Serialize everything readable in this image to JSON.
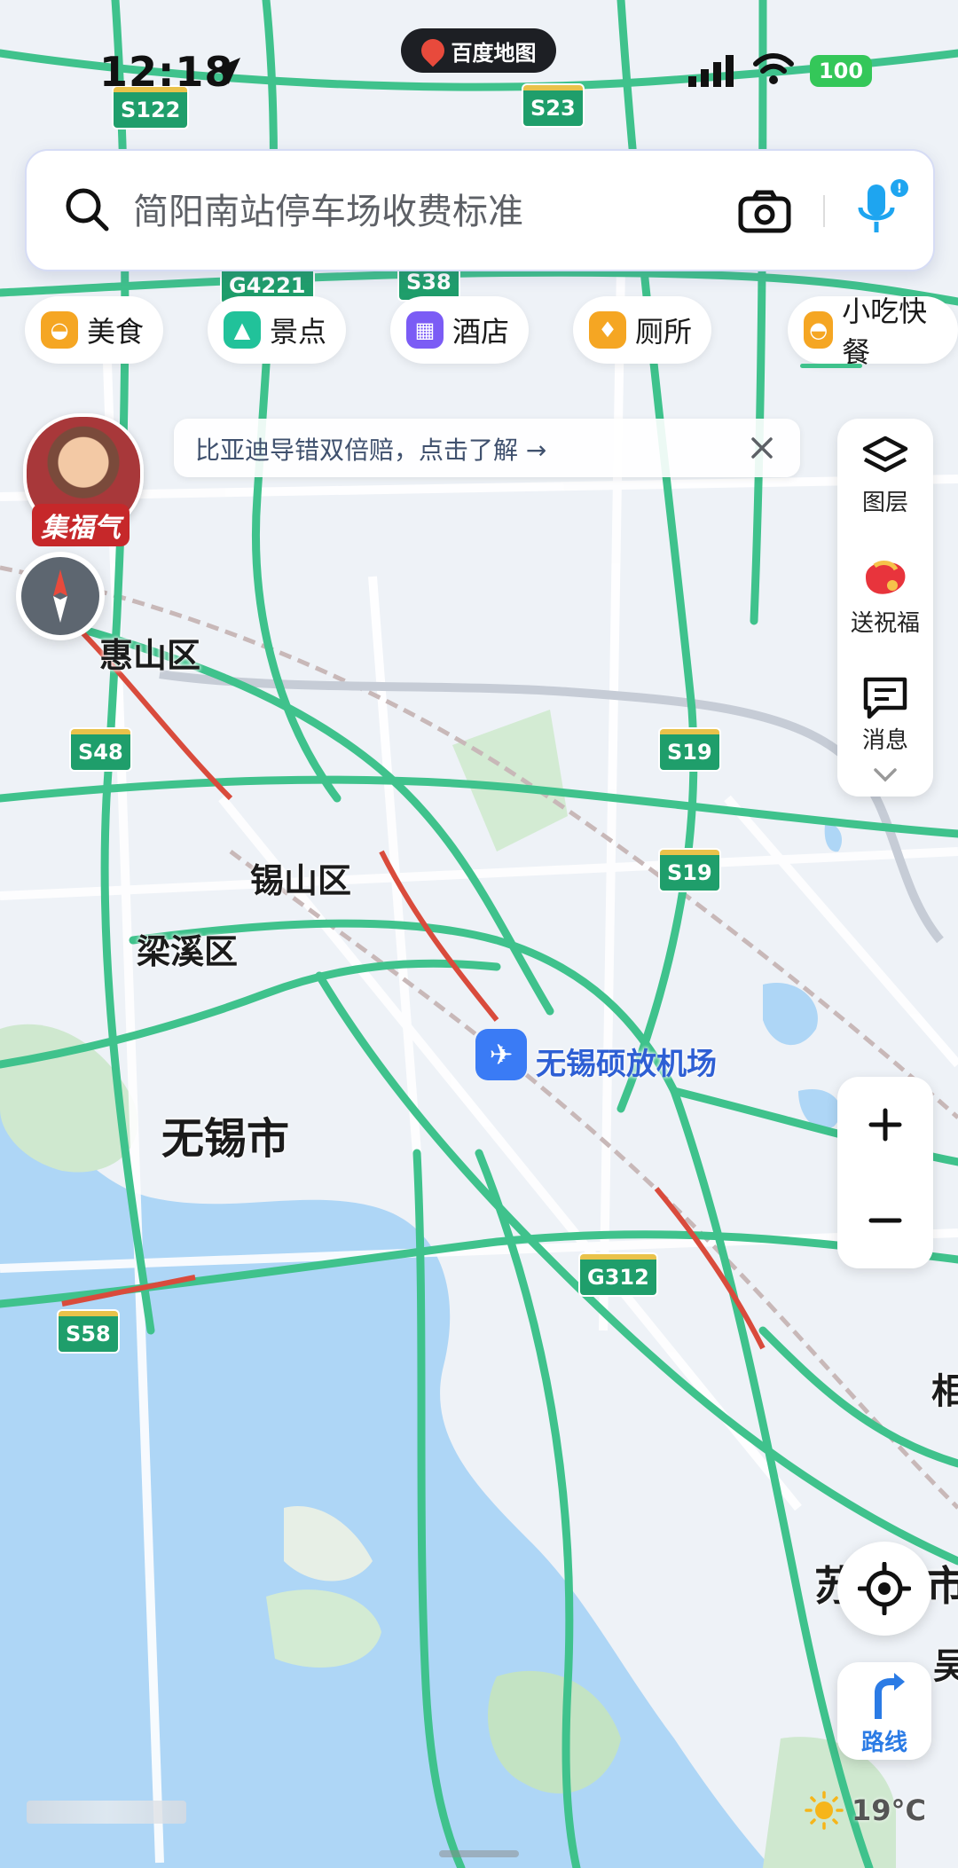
{
  "status": {
    "time": "12:18",
    "battery": "100",
    "brand": "百度地图"
  },
  "search": {
    "placeholder": "简阳南站停车场收费标准"
  },
  "categories": [
    {
      "label": "美食",
      "icon": "food-icon",
      "color": "#f5a623"
    },
    {
      "label": "景点",
      "icon": "scenery-icon",
      "color": "#21c29a"
    },
    {
      "label": "酒店",
      "icon": "hotel-icon",
      "color": "#7b5cf5"
    },
    {
      "label": "厕所",
      "icon": "toilet-icon",
      "color": "#f5a623"
    },
    {
      "label": "小吃快餐",
      "icon": "snack-icon",
      "color": "#f5a623"
    }
  ],
  "notice": {
    "text": "比亚迪导错双倍赔，点击了解 →"
  },
  "avatar": {
    "label": "集福气"
  },
  "right_panel": {
    "layers": "图层",
    "blessing": "送祝福",
    "messages": "消息"
  },
  "map": {
    "districts": [
      "惠山区",
      "锡山区",
      "梁溪区",
      "无锡市"
    ],
    "airport": "无锡硕放机场",
    "partial_labels": [
      "相",
      "苏",
      "市",
      "吴"
    ],
    "roads": [
      "S122",
      "S23",
      "G4221",
      "S38",
      "S48",
      "S19",
      "S19",
      "G312",
      "S58"
    ]
  },
  "bottom": {
    "route": "路线",
    "weather": "19°C"
  }
}
